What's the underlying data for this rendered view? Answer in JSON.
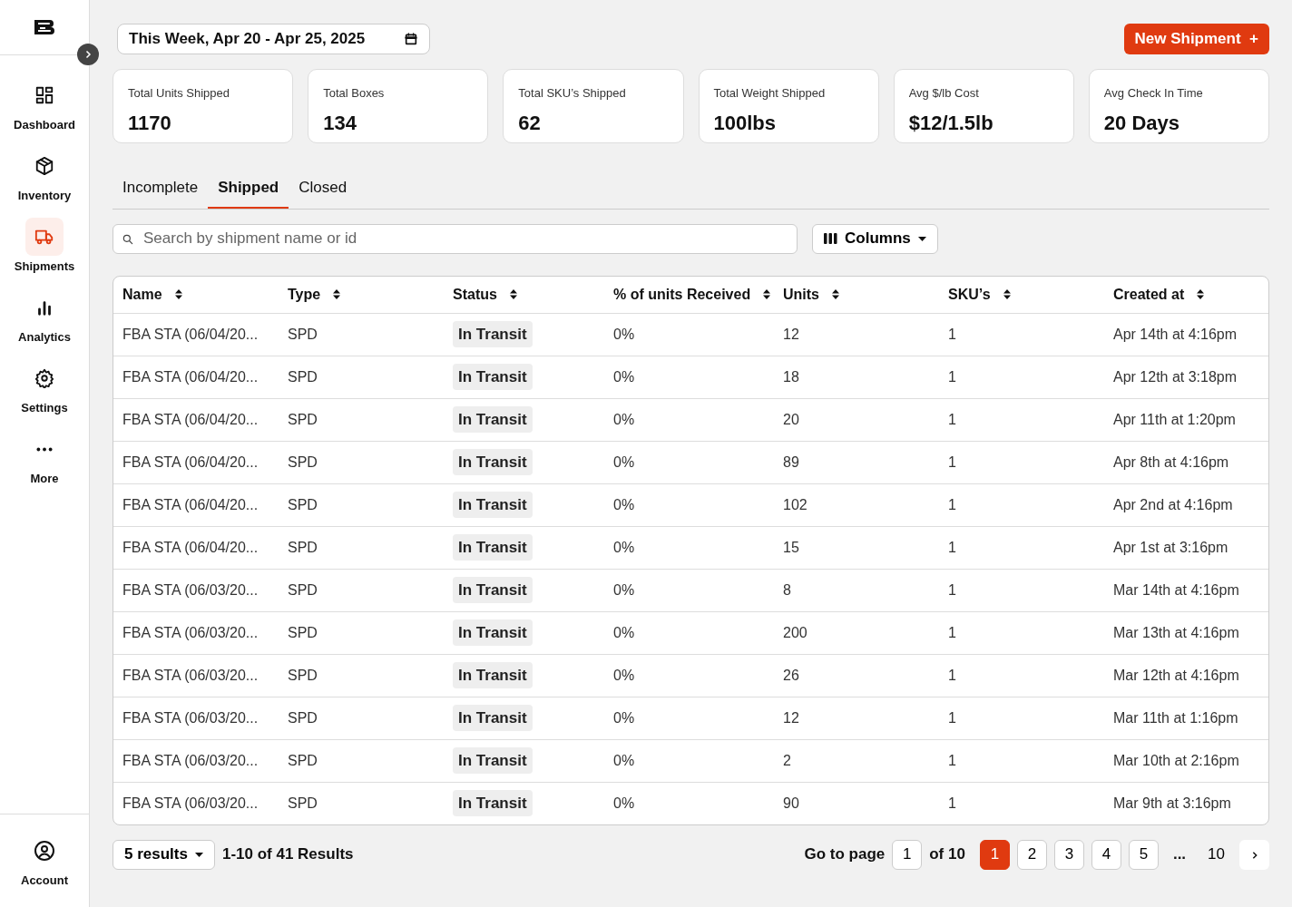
{
  "sidebar": {
    "items": [
      {
        "label": "Dashboard",
        "selected": false
      },
      {
        "label": "Inventory",
        "selected": false
      },
      {
        "label": "Shipments",
        "selected": true
      },
      {
        "label": "Analytics",
        "selected": false
      },
      {
        "label": "Settings",
        "selected": false
      },
      {
        "label": "More",
        "selected": false
      }
    ],
    "account": {
      "label": "Account"
    }
  },
  "date_range": {
    "value": "This Week, Apr 20 - Apr 25, 2025"
  },
  "new_button": {
    "label": "New Shipment",
    "icon": "+"
  },
  "stats": [
    {
      "label": "Total Units Shipped",
      "value": "1170"
    },
    {
      "label": "Total Boxes",
      "value": "134"
    },
    {
      "label": "Total SKU’s Shipped",
      "value": "62"
    },
    {
      "label": "Total Weight Shipped",
      "value": "100lbs"
    },
    {
      "label": "Avg $/lb Cost",
      "value": "$12/1.5lb"
    },
    {
      "label": "Avg Check In Time",
      "value": "20 Days"
    }
  ],
  "tabs": [
    {
      "label": "Incomplete",
      "selected": false
    },
    {
      "label": "Shipped",
      "selected": true
    },
    {
      "label": "Closed",
      "selected": false
    }
  ],
  "search": {
    "placeholder": "Search by shipment name or id"
  },
  "columns_button": {
    "label": "Columns"
  },
  "table": {
    "columns": [
      "Name",
      "Type",
      "Status",
      "% of units Received",
      "Units",
      "SKU’s",
      "Created at"
    ],
    "rows": [
      [
        "FBA STA (06/04/20...",
        "SPD",
        "In Transit",
        "0%",
        "12",
        "1",
        "Apr 14th at 4:16pm"
      ],
      [
        "FBA STA (06/04/20...",
        "SPD",
        "In Transit",
        "0%",
        "18",
        "1",
        "Apr 12th at 3:18pm"
      ],
      [
        "FBA STA (06/04/20...",
        "SPD",
        "In Transit",
        "0%",
        "20",
        "1",
        "Apr 11th at 1:20pm"
      ],
      [
        "FBA STA (06/04/20...",
        "SPD",
        "In Transit",
        "0%",
        "89",
        "1",
        "Apr 8th at 4:16pm"
      ],
      [
        "FBA STA (06/04/20...",
        "SPD",
        "In Transit",
        "0%",
        "102",
        "1",
        "Apr 2nd at 4:16pm"
      ],
      [
        "FBA STA (06/04/20...",
        "SPD",
        "In Transit",
        "0%",
        "15",
        "1",
        "Apr 1st at 3:16pm"
      ],
      [
        "FBA STA (06/03/20...",
        "SPD",
        "In Transit",
        "0%",
        "8",
        "1",
        "Mar 14th at 4:16pm"
      ],
      [
        "FBA STA (06/03/20...",
        "SPD",
        "In Transit",
        "0%",
        "200",
        "1",
        "Mar 13th at 4:16pm"
      ],
      [
        "FBA STA (06/03/20...",
        "SPD",
        "In Transit",
        "0%",
        "26",
        "1",
        "Mar 12th at 4:16pm"
      ],
      [
        "FBA STA (06/03/20...",
        "SPD",
        "In Transit",
        "0%",
        "12",
        "1",
        "Mar 11th at 1:16pm"
      ],
      [
        "FBA STA (06/03/20...",
        "SPD",
        "In Transit",
        "0%",
        "2",
        "1",
        "Mar 10th at 2:16pm"
      ],
      [
        "FBA STA (06/03/20...",
        "SPD",
        "In Transit",
        "0%",
        "90",
        "1",
        "Mar 9th at 3:16pm"
      ]
    ]
  },
  "footer": {
    "page_size": "5 results",
    "summary": "1-10 of 41 Results",
    "goto_label": "Go to page",
    "goto_value": "1",
    "of_label": "of 10",
    "pages": [
      {
        "label": "1",
        "selected": true
      },
      {
        "label": "2",
        "selected": false
      },
      {
        "label": "3",
        "selected": false
      },
      {
        "label": "4",
        "selected": false
      },
      {
        "label": "5",
        "selected": false
      }
    ],
    "ellipsis": "...",
    "last_page": "10"
  }
}
